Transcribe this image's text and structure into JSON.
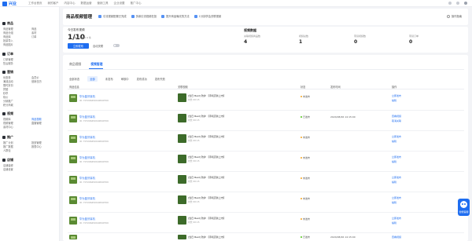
{
  "app": {
    "logo_text": "兴业"
  },
  "topnav": [
    "工作台首页",
    "我的客户",
    "内容中心",
    "数据运营",
    "营销工具",
    "企业设置",
    "推广中心"
  ],
  "sidebar": {
    "groups": [
      {
        "title": "商品",
        "items": [
          "商品管理",
          "商品分组",
          "商品库",
          "批量导入",
          "商品图片"
        ]
      },
      {
        "title": "订单",
        "items": [
          "订单管理",
          "售后服务"
        ]
      },
      {
        "title": "营销",
        "items": [
          "优惠券",
          "满减活动",
          "限时折扣",
          "拼团",
          "秒杀",
          "砍价",
          "分销推广",
          "积分商城",
          "会员价",
          "营销日历"
        ]
      },
      {
        "title": "视频",
        "items": [
          "视频库",
          "视频管理",
          "商品视频",
          "直播管理",
          "素材中心"
        ]
      },
      {
        "title": "推广",
        "items": [
          "推广计划",
          "推广数据",
          "人群包",
          "投放管理",
          "报表中心"
        ]
      },
      {
        "title": "店铺",
        "items": [
          "店铺装修",
          "店铺设置"
        ]
      }
    ],
    "active_item": "商品视频",
    "right_col": [
      "商品",
      "素材",
      "订单"
    ]
  },
  "store": {
    "name": "商品视频管理",
    "tags": [
      "引流视频配置已完成",
      "多款引流视频在投",
      "提升商品曝光的方法",
      "1分钟学会关联视频"
    ],
    "link": "操作指南"
  },
  "today": {
    "label": "今日发布视频",
    "value": "1/10",
    "sub": "剩余可发布 9 条",
    "button": "立即发布",
    "auto_label": "自动关联"
  },
  "metrics": {
    "title": "视频数据",
    "items": [
      {
        "label": "关联视频商品数",
        "value": "4"
      },
      {
        "label": "视频总数",
        "value": "1"
      },
      {
        "label": "带货视频数",
        "value": "0"
      },
      {
        "label": "带货订单",
        "value": "0"
      }
    ]
  },
  "tabs": [
    "商品视频",
    "视频管理"
  ],
  "active_tab": "视频管理",
  "filters": [
    "全部状态",
    "全部",
    "未发布",
    "审核中",
    "发布成功",
    "发布失败"
  ],
  "active_filter": "全部",
  "table": {
    "headers": [
      "商品信息",
      "关联视频",
      "状态",
      "发布时间",
      "操作"
    ],
    "rows": [
      {
        "name": "华为蓝牙耳机",
        "id": "ID: 707206450194840709",
        "video": "[当日 Best] 防护 【手机壳新上市】",
        "video_sub": "时长 00:15",
        "status": "未发布",
        "time": "",
        "ops": [
          "立即发布",
          "编辑"
        ]
      },
      {
        "name": "华为蓝牙耳机",
        "id": "ID: 707206450194840709",
        "video": "[当日 Best] 防护 【手机壳新上市】",
        "video_sub": "时长 00:15",
        "status": "已发布",
        "time": "2024/08/26 14:15:00",
        "ops": [
          "查看视频",
          "取消关联"
        ]
      },
      {
        "name": "华为蓝牙耳机",
        "id": "ID: 707206450194840709",
        "video": "[当日 Best] 防护 【手机壳新上市】",
        "video_sub": "时长 00:15",
        "status": "未发布",
        "time": "",
        "ops": [
          "立即发布",
          "编辑"
        ]
      },
      {
        "name": "华为蓝牙耳机",
        "id": "ID: 707206450194840709",
        "video": "[当日 Best] 防护 【手机壳新上市】",
        "video_sub": "时长 00:15",
        "status": "未发布",
        "time": "",
        "ops": [
          "立即发布",
          "编辑"
        ]
      },
      {
        "name": "华为蓝牙耳机",
        "id": "ID: 707206450194840709",
        "video": "[当日 Best] 防护 【手机壳新上市】",
        "video_sub": "时长 00:15",
        "status": "未发布",
        "time": "",
        "ops": [
          "立即发布",
          "编辑"
        ]
      },
      {
        "name": "华为蓝牙耳机",
        "id": "ID: 707206450194840709",
        "video": "[当日 Best] 防护 【手机壳新上市】",
        "video_sub": "时长 00:15",
        "status": "未发布",
        "time": "",
        "ops": [
          "立即发布",
          "编辑"
        ]
      },
      {
        "name": "华为蓝牙耳机",
        "id": "ID: 707206450194840709",
        "video": "[当日 Best] 防护 【手机壳新上市】",
        "video_sub": "时长 00:15",
        "status": "未发布",
        "time": "",
        "ops": [
          "立即发布",
          "编辑"
        ]
      },
      {
        "name": "华为蓝牙耳机",
        "id": "ID: 707206450194840709",
        "video": "[当日 Best] 防护 【手机壳新上市】",
        "video_sub": "时长 00:15",
        "status": "已发布",
        "time": "2024/08/26 14:15:00",
        "ops": [
          "查看视频",
          "取消关联"
        ]
      }
    ]
  },
  "assistant": {
    "label": "智能客服"
  },
  "colors": {
    "accent": "#1e6df0",
    "warning": "#f5a623"
  }
}
